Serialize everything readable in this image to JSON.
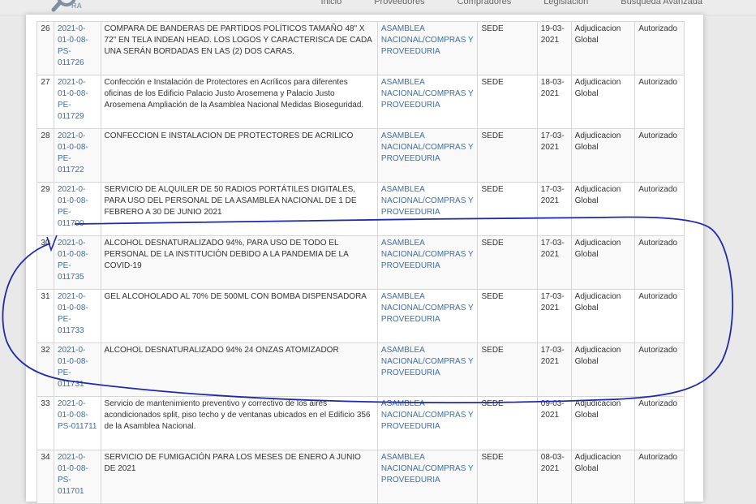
{
  "header": {
    "logo_text": "RA",
    "nav": [
      "Inicio",
      "Proveedores",
      "Compradores",
      "Legislación",
      "Búsqueda Avanzada"
    ]
  },
  "rows": [
    {
      "num": "26",
      "code": "2021-0-01-0-08-PS-011726",
      "desc": "COMPARA DE BANDERAS DE PARTIDOS POLÍTICOS TAMAÑO 48\" X 72\" EN TELA INDEAN HEAD. LOS LOGOS Y CARACTERISCA DE CADA UNA SERÁN BORDADAS EN LAS (2) DOS CARAS.",
      "entity": "ASAMBLEA NACIONAL/COMPRAS Y PROVEEDURIA",
      "sede": "SEDE",
      "date": "19-03-2021",
      "type": "Adjudicacion Global",
      "status": "Autorizado"
    },
    {
      "num": "27",
      "code": "2021-0-01-0-08-PE-011729",
      "desc": "Confección e Instalación de Protectores en Acrílicos para diferentes oficinas de los Edificio Palacio Justo Arosemena y Palacio Justo Arosemena Ampliación de la Asamblea Nacional Medidas Bioseguridad.",
      "entity": "ASAMBLEA NACIONAL/COMPRAS Y PROVEEDURIA",
      "sede": "SEDE",
      "date": "18-03-2021",
      "type": "Adjudicacion Global",
      "status": "Autorizado"
    },
    {
      "num": "28",
      "code": "2021-0-01-0-08-PE-011722",
      "desc": "CONFECCION E INSTALACION DE PROTECTORES DE ACRILICO",
      "entity": "ASAMBLEA NACIONAL/COMPRAS Y PROVEEDURIA",
      "sede": "SEDE",
      "date": "17-03-2021",
      "type": "Adjudicacion Global",
      "status": "Autorizado"
    },
    {
      "num": "29",
      "code": "2021-0-01-0-08-PE-011700",
      "desc": "SERVICIO DE ALQUILER DE 50 RADIOS PORTÁTILES DIGITALES, PARA USO DEL PERSONAL DE LA ASAMBLEA NACIONAL DE 1 DE FEBRERO A 30 DE JUNIO 2021",
      "entity": "ASAMBLEA NACIONAL/COMPRAS Y PROVEEDURIA",
      "sede": "SEDE",
      "date": "17-03-2021",
      "type": "Adjudicacion Global",
      "status": "Autorizado"
    },
    {
      "num": "30",
      "code": "2021-0-01-0-08-PE-011735",
      "desc": "ALCOHOL DESNATURALIZADO 94%, PARA USO DE TODO EL PERSONAL DE LA INSTITUCIÓN DEBIDO A LA PANDEMIA DE LA COVID-19",
      "entity": "ASAMBLEA NACIONAL/COMPRAS Y PROVEEDURIA",
      "sede": "SEDE",
      "date": "17-03-2021",
      "type": "Adjudicacion Global",
      "status": "Autorizado"
    },
    {
      "num": "31",
      "code": "2021-0-01-0-08-PE-011733",
      "desc": "GEL ALCOHOLADO AL 70% DE 500ML CON BOMBA DISPENSADORA",
      "entity": "ASAMBLEA NACIONAL/COMPRAS Y PROVEEDURIA",
      "sede": "SEDE",
      "date": "17-03-2021",
      "type": "Adjudicacion Global",
      "status": "Autorizado"
    },
    {
      "num": "32",
      "code": "2021-0-01-0-08-PE-011731",
      "desc": "ALCOHOL DESNATURALIZADO 94% 24 ONZAS ATOMIZADOR",
      "entity": "ASAMBLEA NACIONAL/COMPRAS Y PROVEEDURIA",
      "sede": "SEDE",
      "date": "17-03-2021",
      "type": "Adjudicacion Global",
      "status": "Autorizado"
    },
    {
      "num": "33",
      "code": "2021-0-01-0-08-PS-011711",
      "desc": "Servicio de mantenimiento preventivo y correctivo de los aires acondicionados split, piso techo y de ventanas ubicados en el Edificio 356 de la Asamblea Nacional.",
      "entity": "ASAMBLEA NACIONAL/COMPRAS Y PROVEEDURIA",
      "sede": "SEDE",
      "date": "09-03-2021",
      "type": "Adjudicacion Global",
      "status": "Autorizado"
    },
    {
      "num": "34",
      "code": "2021-0-01-0-08-PS-011701",
      "desc": "SERVICIO DE FUMIGACIÓN PARA LOS MESES DE ENERO A JUNIO DE 2021",
      "entity": "ASAMBLEA NACIONAL/COMPRAS Y PROVEEDURIA",
      "sede": "SEDE",
      "date": "08-03-2021",
      "type": "Adjudicacion Global",
      "status": "Autorizado"
    }
  ],
  "colors": {
    "link": "#3a6fa8",
    "annotation": "#1f2aa8"
  },
  "icons": {
    "logo": "magnifier-icon"
  }
}
